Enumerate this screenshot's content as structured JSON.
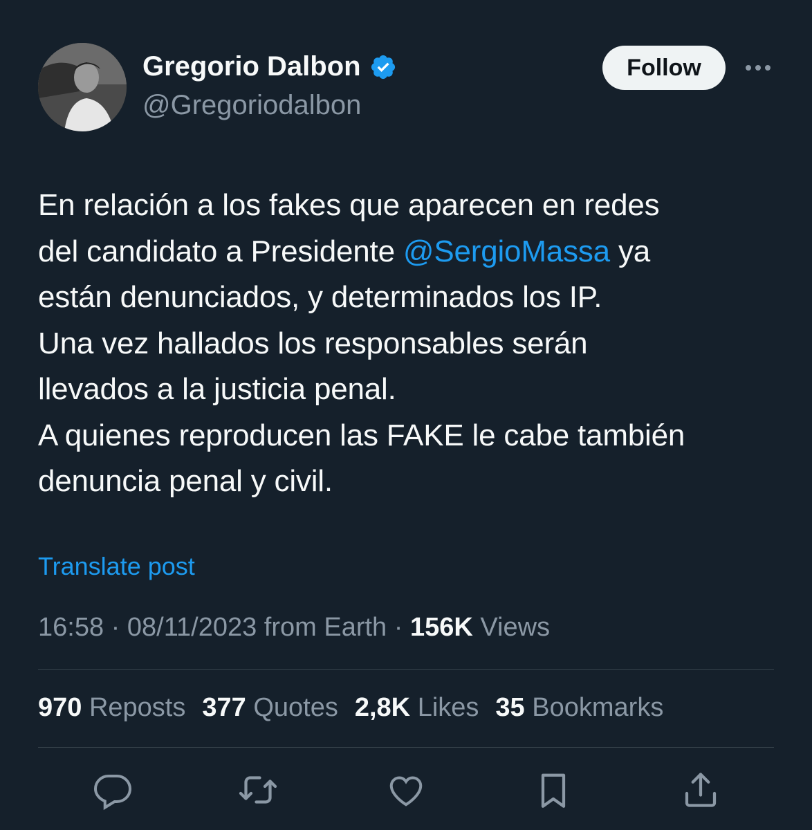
{
  "author": {
    "display_name": "Gregorio Dalbon",
    "handle": "@Gregoriodalbon",
    "verified": true,
    "avatar_icon": "profile-photo"
  },
  "header": {
    "follow_label": "Follow",
    "more_icon": "more-horizontal-icon"
  },
  "tweet": {
    "lines": [
      {
        "text": "En relación a los fakes que aparecen en redes"
      },
      {
        "before": "del candidato a Presidente ",
        "mention": "@SergioMassa",
        "after": " ya"
      },
      {
        "text": "están denunciados, y determinados los IP."
      },
      {
        "text": "Una vez hallados los responsables serán"
      },
      {
        "text": "llevados a la justicia penal."
      },
      {
        "text": "A quienes reproducen las FAKE le cabe también"
      },
      {
        "text": "denuncia penal y civil."
      }
    ],
    "translate_label": "Translate post"
  },
  "meta": {
    "time": "16:58",
    "separator": " · ",
    "date": "08/11/2023",
    "source": " from Earth",
    "views_count": "156K",
    "views_label": " Views"
  },
  "stats": {
    "reposts_count": "970",
    "reposts_label": " Repostss",
    "quotes_count": "377",
    "quotes_label": " Quotes",
    "likes_count": "2,8K",
    "likes_label": " Likes",
    "bookmarks_count": "35",
    "bookmarks_label": " Bookmarks"
  },
  "actions": [
    "reply-icon",
    "repost-icon",
    "like-icon",
    "bookmark-icon",
    "share-icon"
  ],
  "colors": {
    "background": "#15202b",
    "accent": "#1d9bf0",
    "text_primary": "#f7f9f9",
    "text_secondary": "#8b98a5",
    "divider": "#38444d"
  }
}
